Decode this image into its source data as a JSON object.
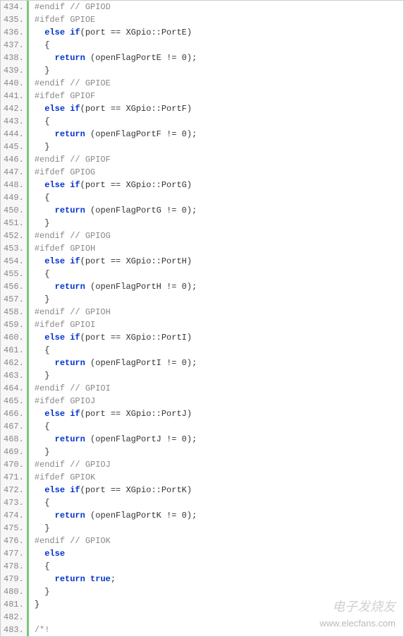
{
  "lines": [
    {
      "num": "434.",
      "tokens": [
        {
          "cls": "preproc",
          "txt": "#endif // GPIOD"
        }
      ]
    },
    {
      "num": "435.",
      "tokens": [
        {
          "cls": "preproc",
          "txt": "#ifdef GPIOE"
        }
      ]
    },
    {
      "num": "436.",
      "tokens": [
        {
          "cls": "normal",
          "txt": "  "
        },
        {
          "cls": "keyword",
          "txt": "else"
        },
        {
          "cls": "normal",
          "txt": " "
        },
        {
          "cls": "keyword",
          "txt": "if"
        },
        {
          "cls": "normal",
          "txt": "(port == XGpio::PortE)"
        }
      ]
    },
    {
      "num": "437.",
      "tokens": [
        {
          "cls": "normal",
          "txt": "  {"
        }
      ]
    },
    {
      "num": "438.",
      "tokens": [
        {
          "cls": "normal",
          "txt": "    "
        },
        {
          "cls": "keyword",
          "txt": "return"
        },
        {
          "cls": "normal",
          "txt": " (openFlagPortE != 0);"
        }
      ]
    },
    {
      "num": "439.",
      "tokens": [
        {
          "cls": "normal",
          "txt": "  }"
        }
      ]
    },
    {
      "num": "440.",
      "tokens": [
        {
          "cls": "preproc",
          "txt": "#endif // GPIOE"
        }
      ]
    },
    {
      "num": "441.",
      "tokens": [
        {
          "cls": "preproc",
          "txt": "#ifdef GPIOF"
        }
      ]
    },
    {
      "num": "442.",
      "tokens": [
        {
          "cls": "normal",
          "txt": "  "
        },
        {
          "cls": "keyword",
          "txt": "else"
        },
        {
          "cls": "normal",
          "txt": " "
        },
        {
          "cls": "keyword",
          "txt": "if"
        },
        {
          "cls": "normal",
          "txt": "(port == XGpio::PortF)"
        }
      ]
    },
    {
      "num": "443.",
      "tokens": [
        {
          "cls": "normal",
          "txt": "  {"
        }
      ]
    },
    {
      "num": "444.",
      "tokens": [
        {
          "cls": "normal",
          "txt": "    "
        },
        {
          "cls": "keyword",
          "txt": "return"
        },
        {
          "cls": "normal",
          "txt": " (openFlagPortF != 0);"
        }
      ]
    },
    {
      "num": "445.",
      "tokens": [
        {
          "cls": "normal",
          "txt": "  }"
        }
      ]
    },
    {
      "num": "446.",
      "tokens": [
        {
          "cls": "preproc",
          "txt": "#endif // GPIOF"
        }
      ]
    },
    {
      "num": "447.",
      "tokens": [
        {
          "cls": "preproc",
          "txt": "#ifdef GPIOG"
        }
      ]
    },
    {
      "num": "448.",
      "tokens": [
        {
          "cls": "normal",
          "txt": "  "
        },
        {
          "cls": "keyword",
          "txt": "else"
        },
        {
          "cls": "normal",
          "txt": " "
        },
        {
          "cls": "keyword",
          "txt": "if"
        },
        {
          "cls": "normal",
          "txt": "(port == XGpio::PortG)"
        }
      ]
    },
    {
      "num": "449.",
      "tokens": [
        {
          "cls": "normal",
          "txt": "  {"
        }
      ]
    },
    {
      "num": "450.",
      "tokens": [
        {
          "cls": "normal",
          "txt": "    "
        },
        {
          "cls": "keyword",
          "txt": "return"
        },
        {
          "cls": "normal",
          "txt": " (openFlagPortG != 0);"
        }
      ]
    },
    {
      "num": "451.",
      "tokens": [
        {
          "cls": "normal",
          "txt": "  }"
        }
      ]
    },
    {
      "num": "452.",
      "tokens": [
        {
          "cls": "preproc",
          "txt": "#endif // GPIOG"
        }
      ]
    },
    {
      "num": "453.",
      "tokens": [
        {
          "cls": "preproc",
          "txt": "#ifdef GPIOH"
        }
      ]
    },
    {
      "num": "454.",
      "tokens": [
        {
          "cls": "normal",
          "txt": "  "
        },
        {
          "cls": "keyword",
          "txt": "else"
        },
        {
          "cls": "normal",
          "txt": " "
        },
        {
          "cls": "keyword",
          "txt": "if"
        },
        {
          "cls": "normal",
          "txt": "(port == XGpio::PortH)"
        }
      ]
    },
    {
      "num": "455.",
      "tokens": [
        {
          "cls": "normal",
          "txt": "  {"
        }
      ]
    },
    {
      "num": "456.",
      "tokens": [
        {
          "cls": "normal",
          "txt": "    "
        },
        {
          "cls": "keyword",
          "txt": "return"
        },
        {
          "cls": "normal",
          "txt": " (openFlagPortH != 0);"
        }
      ]
    },
    {
      "num": "457.",
      "tokens": [
        {
          "cls": "normal",
          "txt": "  }"
        }
      ]
    },
    {
      "num": "458.",
      "tokens": [
        {
          "cls": "preproc",
          "txt": "#endif // GPIOH"
        }
      ]
    },
    {
      "num": "459.",
      "tokens": [
        {
          "cls": "preproc",
          "txt": "#ifdef GPIOI"
        }
      ]
    },
    {
      "num": "460.",
      "tokens": [
        {
          "cls": "normal",
          "txt": "  "
        },
        {
          "cls": "keyword",
          "txt": "else"
        },
        {
          "cls": "normal",
          "txt": " "
        },
        {
          "cls": "keyword",
          "txt": "if"
        },
        {
          "cls": "normal",
          "txt": "(port == XGpio::PortI)"
        }
      ]
    },
    {
      "num": "461.",
      "tokens": [
        {
          "cls": "normal",
          "txt": "  {"
        }
      ]
    },
    {
      "num": "462.",
      "tokens": [
        {
          "cls": "normal",
          "txt": "    "
        },
        {
          "cls": "keyword",
          "txt": "return"
        },
        {
          "cls": "normal",
          "txt": " (openFlagPortI != 0);"
        }
      ]
    },
    {
      "num": "463.",
      "tokens": [
        {
          "cls": "normal",
          "txt": "  }"
        }
      ]
    },
    {
      "num": "464.",
      "tokens": [
        {
          "cls": "preproc",
          "txt": "#endif // GPIOI"
        }
      ]
    },
    {
      "num": "465.",
      "tokens": [
        {
          "cls": "preproc",
          "txt": "#ifdef GPIOJ"
        }
      ]
    },
    {
      "num": "466.",
      "tokens": [
        {
          "cls": "normal",
          "txt": "  "
        },
        {
          "cls": "keyword",
          "txt": "else"
        },
        {
          "cls": "normal",
          "txt": " "
        },
        {
          "cls": "keyword",
          "txt": "if"
        },
        {
          "cls": "normal",
          "txt": "(port == XGpio::PortJ)"
        }
      ]
    },
    {
      "num": "467.",
      "tokens": [
        {
          "cls": "normal",
          "txt": "  {"
        }
      ]
    },
    {
      "num": "468.",
      "tokens": [
        {
          "cls": "normal",
          "txt": "    "
        },
        {
          "cls": "keyword",
          "txt": "return"
        },
        {
          "cls": "normal",
          "txt": " (openFlagPortJ != 0);"
        }
      ]
    },
    {
      "num": "469.",
      "tokens": [
        {
          "cls": "normal",
          "txt": "  }"
        }
      ]
    },
    {
      "num": "470.",
      "tokens": [
        {
          "cls": "preproc",
          "txt": "#endif // GPIOJ"
        }
      ]
    },
    {
      "num": "471.",
      "tokens": [
        {
          "cls": "preproc",
          "txt": "#ifdef GPIOK"
        }
      ]
    },
    {
      "num": "472.",
      "tokens": [
        {
          "cls": "normal",
          "txt": "  "
        },
        {
          "cls": "keyword",
          "txt": "else"
        },
        {
          "cls": "normal",
          "txt": " "
        },
        {
          "cls": "keyword",
          "txt": "if"
        },
        {
          "cls": "normal",
          "txt": "(port == XGpio::PortK)"
        }
      ]
    },
    {
      "num": "473.",
      "tokens": [
        {
          "cls": "normal",
          "txt": "  {"
        }
      ]
    },
    {
      "num": "474.",
      "tokens": [
        {
          "cls": "normal",
          "txt": "    "
        },
        {
          "cls": "keyword",
          "txt": "return"
        },
        {
          "cls": "normal",
          "txt": " (openFlagPortK != 0);"
        }
      ]
    },
    {
      "num": "475.",
      "tokens": [
        {
          "cls": "normal",
          "txt": "  }"
        }
      ]
    },
    {
      "num": "476.",
      "tokens": [
        {
          "cls": "preproc",
          "txt": "#endif // GPIOK"
        }
      ]
    },
    {
      "num": "477.",
      "tokens": [
        {
          "cls": "normal",
          "txt": "  "
        },
        {
          "cls": "keyword",
          "txt": "else"
        }
      ]
    },
    {
      "num": "478.",
      "tokens": [
        {
          "cls": "normal",
          "txt": "  {"
        }
      ]
    },
    {
      "num": "479.",
      "tokens": [
        {
          "cls": "normal",
          "txt": "    "
        },
        {
          "cls": "keyword",
          "txt": "return"
        },
        {
          "cls": "normal",
          "txt": " "
        },
        {
          "cls": "keyword",
          "txt": "true"
        },
        {
          "cls": "normal",
          "txt": ";"
        }
      ]
    },
    {
      "num": "480.",
      "tokens": [
        {
          "cls": "normal",
          "txt": "  }"
        }
      ]
    },
    {
      "num": "481.",
      "tokens": [
        {
          "cls": "normal",
          "txt": "}"
        }
      ]
    },
    {
      "num": "482.",
      "tokens": [
        {
          "cls": "normal",
          "txt": ""
        }
      ]
    },
    {
      "num": "483.",
      "tokens": [
        {
          "cls": "preproc",
          "txt": "/*!"
        }
      ]
    }
  ],
  "watermark": {
    "brand": "电子发烧友",
    "url": "www.elecfans.com"
  }
}
